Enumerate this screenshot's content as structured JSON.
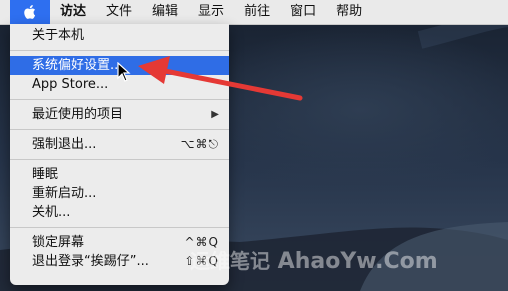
{
  "menubar": {
    "items": [
      {
        "label": "访达",
        "bold": true
      },
      {
        "label": "文件"
      },
      {
        "label": "编辑"
      },
      {
        "label": "显示"
      },
      {
        "label": "前往"
      },
      {
        "label": "窗口"
      },
      {
        "label": "帮助"
      }
    ]
  },
  "apple_menu": {
    "about": "关于本机",
    "system_prefs": "系统偏好设置...",
    "app_store": "App Store...",
    "recent_items": "最近使用的项目",
    "force_quit": "强制退出...",
    "force_quit_shortcut": "⌥⌘⎋",
    "sleep": "睡眠",
    "restart": "重新启动...",
    "shutdown": "关机...",
    "lock_screen": "锁定屏幕",
    "lock_screen_shortcut": "^⌘Q",
    "logout": "退出登录“挨踢仔”...",
    "logout_shortcut": "⇧⌘Q"
  },
  "watermark": {
    "cn": "运维笔记",
    "en": "AhaoYw.Com"
  },
  "colors": {
    "menubar_bg": "#eaeaea",
    "menu_bg": "#ececec",
    "selection": "#2f6de6",
    "annotation_arrow": "#e53935"
  }
}
